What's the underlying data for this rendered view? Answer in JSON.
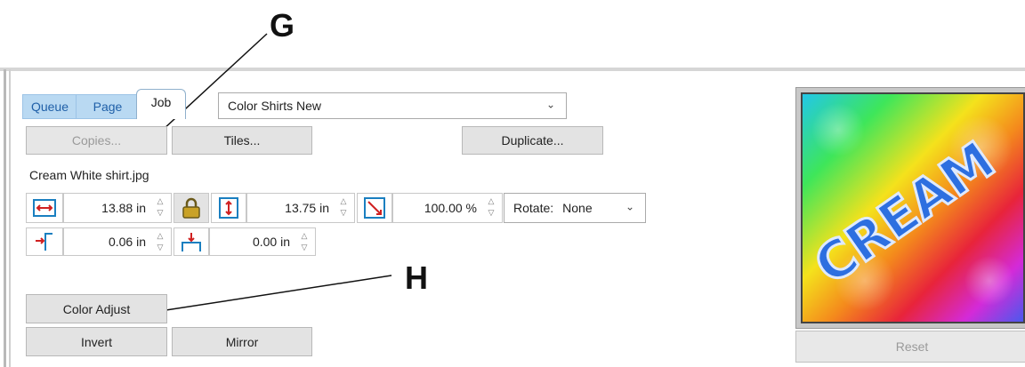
{
  "callouts": {
    "g": "G",
    "h": "H"
  },
  "tabs": {
    "queue": "Queue",
    "page": "Page",
    "job": "Job"
  },
  "profile_select": {
    "value": "Color Shirts New"
  },
  "buttons": {
    "copies": "Copies...",
    "tiles": "Tiles...",
    "duplicate": "Duplicate...",
    "color_adjust": "Color Adjust",
    "invert": "Invert",
    "mirror": "Mirror",
    "reset": "Reset"
  },
  "file": {
    "name": "Cream White shirt.jpg"
  },
  "dimensions": {
    "width": "13.88 in",
    "height": "13.75 in",
    "scale": "100.00 %",
    "offset_x": "0.06 in",
    "offset_y": "0.00 in"
  },
  "rotate": {
    "label": "Rotate:",
    "value": "None"
  },
  "preview": {
    "text": "CREAM"
  },
  "icons": {
    "width": "width-arrows-icon",
    "lock": "lock-icon",
    "height": "height-arrows-icon",
    "scale": "scale-diagonal-icon",
    "offset_x": "left-offset-icon",
    "offset_y": "top-offset-icon"
  },
  "colors": {
    "icon_accent": "#1a7fc0",
    "arrow_red": "#d02020",
    "tab_blue": "#b9d9f2"
  }
}
